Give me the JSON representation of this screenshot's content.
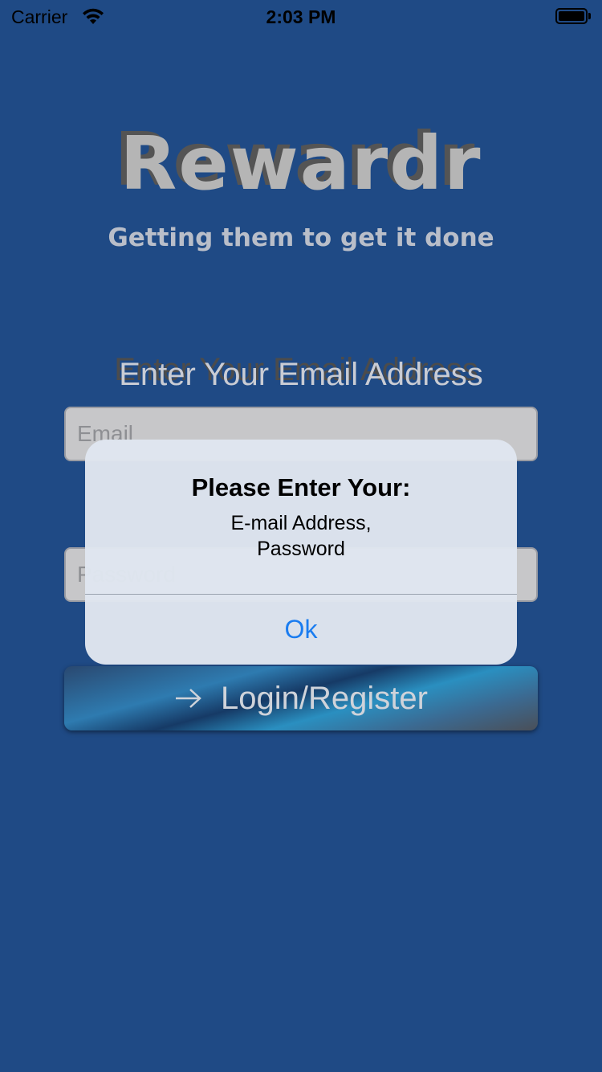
{
  "status_bar": {
    "carrier": "Carrier",
    "time": "2:03 PM",
    "wifi_icon": "wifi-icon",
    "battery_icon": "battery-icon"
  },
  "app": {
    "title": "Rewardr",
    "tagline": "Getting them to get it done"
  },
  "form": {
    "email_prompt": "Enter Your Email Address",
    "email_placeholder": "Email",
    "password_placeholder": "Password",
    "login_label": "Login/Register",
    "login_icon": "arrow-right-icon"
  },
  "alert": {
    "title": "Please Enter Your:",
    "message_line1": "E-mail Address,",
    "message_line2": "Password",
    "ok_label": "Ok"
  },
  "colors": {
    "background": "#1f4a85",
    "alert_button": "#1a7cf0"
  }
}
